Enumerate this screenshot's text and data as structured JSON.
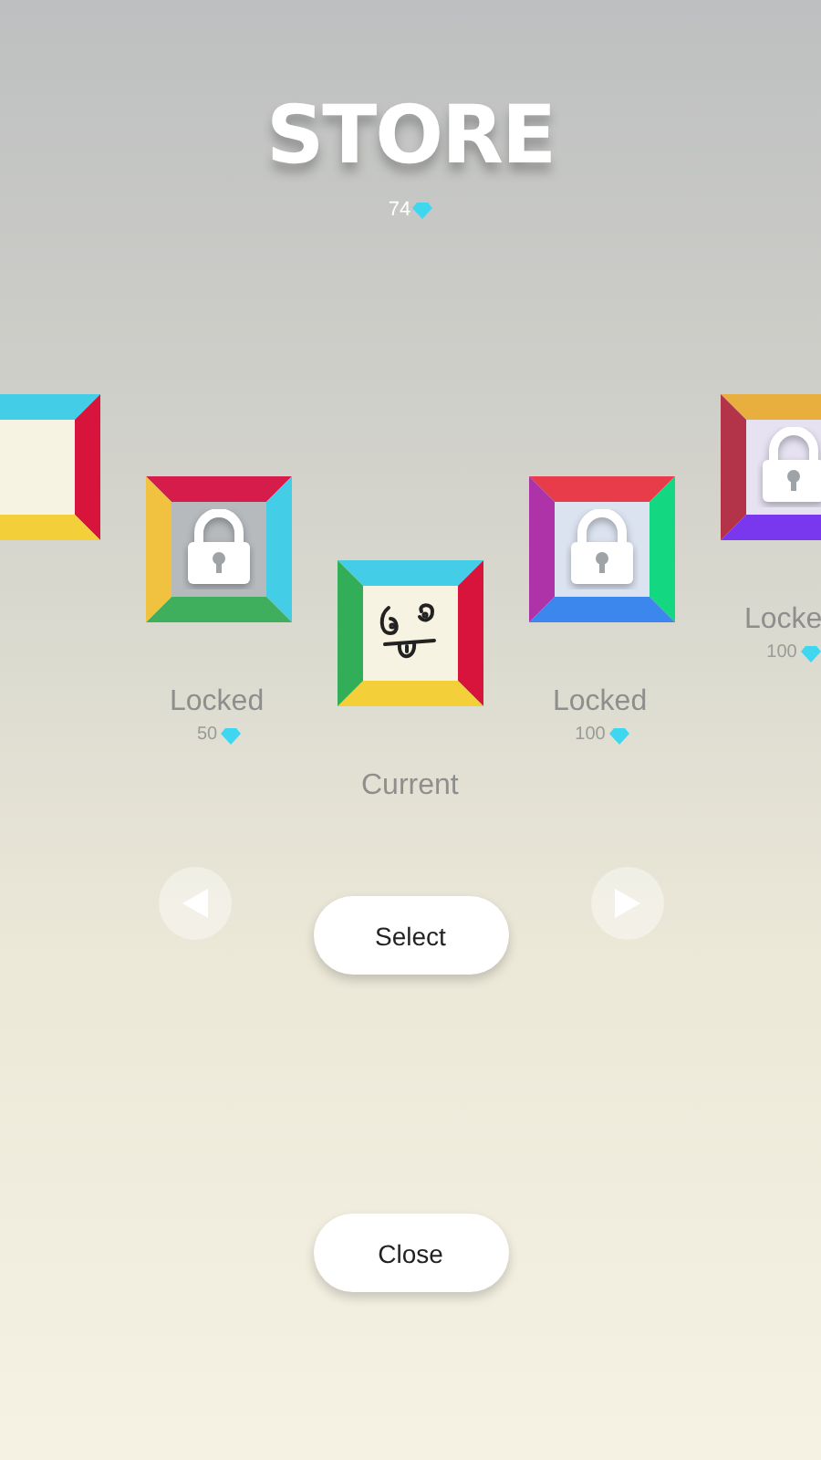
{
  "title": "STORE",
  "gems": "74",
  "skins": [
    {
      "kind": "empty"
    },
    {
      "kind": "locked",
      "label": "Locked",
      "price": "50"
    },
    {
      "kind": "face",
      "label": "Current"
    },
    {
      "kind": "locked",
      "label": "Locked",
      "price": "100"
    },
    {
      "kind": "locked",
      "label": "Locke",
      "price": "100"
    }
  ],
  "select_button": "Select",
  "close_button": "Close"
}
